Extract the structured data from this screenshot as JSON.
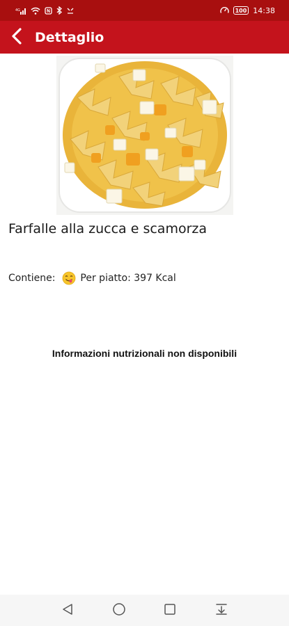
{
  "status_bar": {
    "time": "14:38",
    "battery": "100",
    "icons": [
      "signal-icon",
      "wifi-icon",
      "nfc-icon",
      "bluetooth-icon",
      "alarm-icon",
      "speed-icon",
      "battery-icon"
    ]
  },
  "app_bar": {
    "title": "Dettaglio",
    "back_icon": "chevron-left-icon"
  },
  "dish": {
    "image": "dish-photo",
    "title": "Farfalle alla zucca e scamorza",
    "contains_label": "Contiene:",
    "emoji": "yum-emoji",
    "calories_text": "Per piatto: 397 Kcal"
  },
  "nutrition": {
    "message": "Informazioni nutrizionali non disponibili"
  },
  "nav_bar": {
    "items": [
      "back-triangle-icon",
      "home-circle-icon",
      "recents-square-icon",
      "notification-pull-icon"
    ]
  },
  "colors": {
    "status_bar": "#a80f0f",
    "app_bar": "#c4131c",
    "nav_bar": "#f6f6f6"
  }
}
